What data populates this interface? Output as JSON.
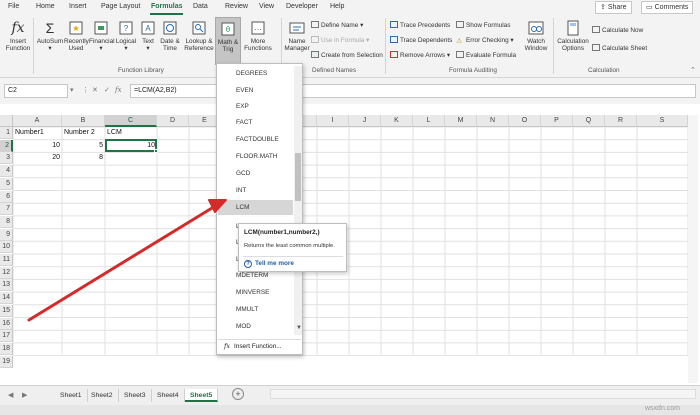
{
  "menu": {
    "tabs": [
      "File",
      "Home",
      "Insert",
      "Page Layout",
      "Formulas",
      "Data",
      "Review",
      "View",
      "Developer",
      "Help"
    ],
    "active_tab": "Formulas",
    "share": "Share",
    "comments": "Comments"
  },
  "ribbon": {
    "insert_function": [
      "Insert",
      "Function"
    ],
    "autosum": "AutoSum",
    "recently_used": [
      "Recently",
      "Used"
    ],
    "financial": "Financial",
    "logical": "Logical",
    "text": "Text",
    "date_time": [
      "Date &",
      "Time"
    ],
    "lookup_reference": [
      "Lookup &",
      "Reference"
    ],
    "math_trig": [
      "Math &",
      "Trig"
    ],
    "more_functions": [
      "More",
      "Functions"
    ],
    "function_library_label": "Function Library",
    "name_manager": [
      "Name",
      "Manager"
    ],
    "define_name": "Define Name",
    "use_in_formula": "Use in Formula",
    "create_from_selection": "Create from Selection",
    "defined_names_label": "Defined Names",
    "trace_precedents": "Trace Precedents",
    "trace_dependents": "Trace Dependents",
    "remove_arrows": "Remove Arrows",
    "show_formulas": "Show Formulas",
    "error_checking": "Error Checking",
    "evaluate_formula": "Evaluate Formula",
    "watch_window": [
      "Watch",
      "Window"
    ],
    "formula_auditing_label": "Formula Auditing",
    "calculation_options": [
      "Calculation",
      "Options"
    ],
    "calculate_now": "Calculate Now",
    "calculate_sheet": "Calculate Sheet",
    "calculation_label": "Calculation"
  },
  "formula_bar": {
    "name_box": "C2",
    "formula": "=LCM(A2,B2)"
  },
  "grid": {
    "columns": [
      "A",
      "B",
      "C",
      "D",
      "E",
      "F",
      "G",
      "H",
      "I",
      "J",
      "K",
      "L",
      "M",
      "N",
      "O",
      "P",
      "Q",
      "R",
      "S"
    ],
    "rows": [
      "1",
      "2",
      "3",
      "4",
      "5",
      "6",
      "7",
      "8",
      "9",
      "10",
      "11",
      "12",
      "13",
      "14",
      "15",
      "16",
      "17",
      "18",
      "19"
    ],
    "cells": {
      "A1": "Number1",
      "B1": "Number 2",
      "C1": "LCM",
      "A2": "10",
      "B2": "5",
      "C2": "10",
      "A3": "20",
      "B3": "8"
    }
  },
  "function_menu": {
    "items": [
      "DEGREES",
      "EVEN",
      "EXP",
      "FACT",
      "FACTDOUBLE",
      "FLOOR.MATH",
      "GCD",
      "INT",
      "LCM",
      "L",
      "L",
      "L",
      "MDETERM",
      "MINVERSE",
      "MMULT",
      "MOD"
    ],
    "highlighted": "LCM",
    "insert_function": "Insert Function..."
  },
  "tooltip": {
    "signature": "LCM(number1,number2,)",
    "description": "Returns the least common multiple.",
    "tell_me_more": "Tell me more"
  },
  "sheets": {
    "tabs": [
      "Sheet1",
      "Sheet2",
      "Sheet3",
      "Sheet4",
      "Sheet5"
    ],
    "active": "Sheet5"
  },
  "watermark": "wsxdn.com",
  "colors": {
    "accent": "#217346",
    "arrow": "#d42a2a"
  }
}
